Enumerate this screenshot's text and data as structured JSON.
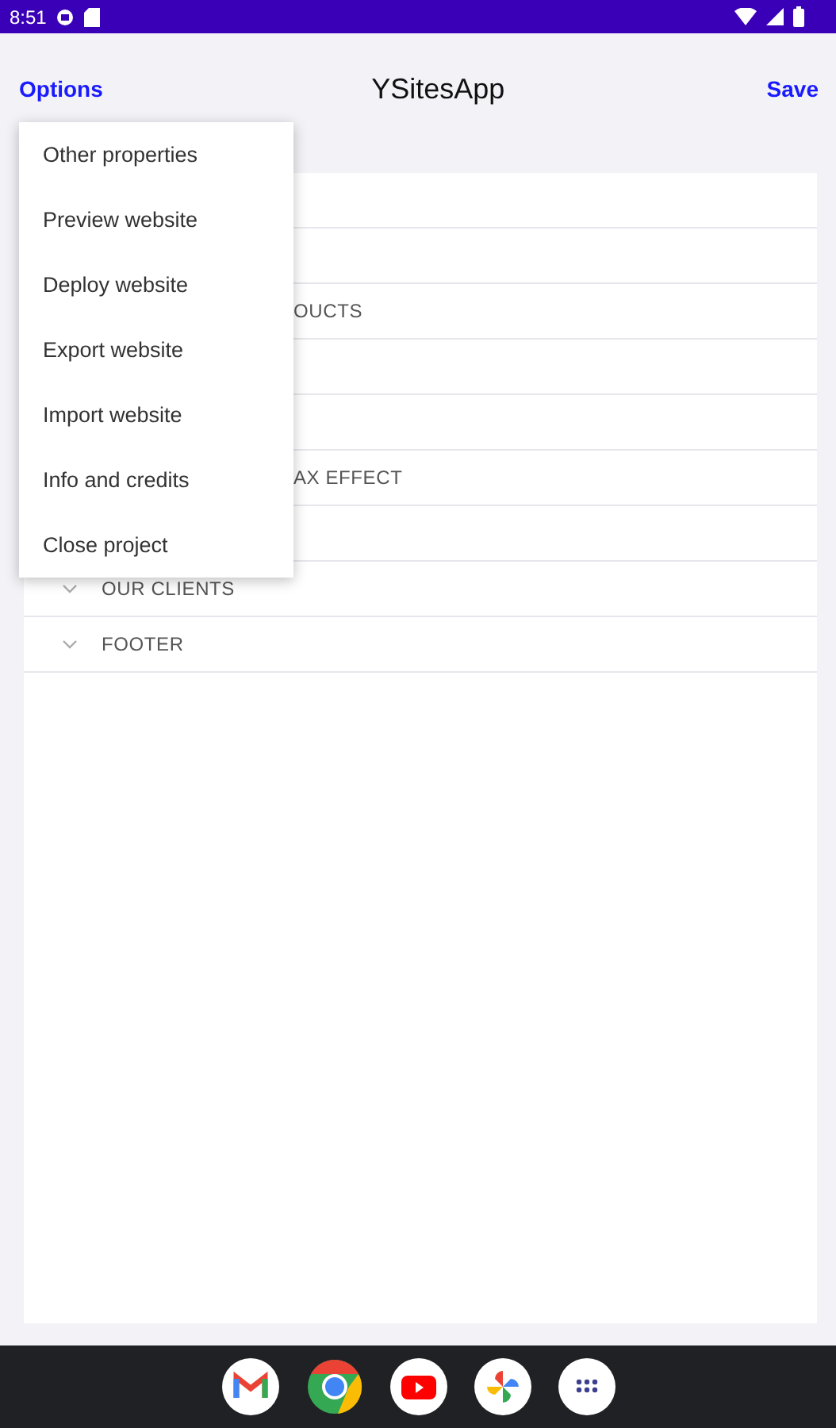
{
  "status_bar": {
    "time": "8:51"
  },
  "header": {
    "left_button": "Options",
    "title": "YSitesApp",
    "right_button": "Save"
  },
  "sections": [
    {
      "kind": "covered"
    },
    {
      "kind": "covered"
    },
    {
      "kind": "cut",
      "label": "OUCTS"
    },
    {
      "kind": "covered"
    },
    {
      "kind": "covered"
    },
    {
      "kind": "cut",
      "label": "AX EFFECT"
    },
    {
      "kind": "covered"
    },
    {
      "kind": "full",
      "label": "OUR CLIENTS"
    },
    {
      "kind": "full",
      "label": "FOOTER"
    }
  ],
  "menu": [
    "Other properties",
    "Preview website",
    "Deploy website",
    "Export website",
    "Import website",
    "Info and credits",
    "Close project"
  ],
  "dock": [
    {
      "kind": "mail"
    },
    {
      "kind": "browser"
    },
    {
      "kind": "video"
    },
    {
      "kind": "photos"
    },
    {
      "kind": "apps"
    }
  ]
}
